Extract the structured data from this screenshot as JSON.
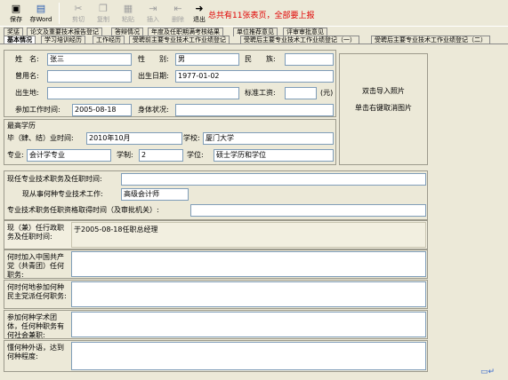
{
  "toolbar": {
    "buttons": [
      {
        "label": "保存",
        "icon": "save-icon",
        "enabled": true
      },
      {
        "label": "存Word",
        "icon": "word-icon",
        "enabled": true
      },
      {
        "label": "剪切",
        "icon": "cut-icon",
        "enabled": false
      },
      {
        "label": "复制",
        "icon": "copy-icon",
        "enabled": false
      },
      {
        "label": "粘贴",
        "icon": "paste-icon",
        "enabled": false
      },
      {
        "label": "插入",
        "icon": "insert-icon",
        "enabled": false
      },
      {
        "label": "删除",
        "icon": "delete-icon",
        "enabled": false
      },
      {
        "label": "退出",
        "icon": "exit-icon",
        "enabled": true
      }
    ],
    "notice": "总共有11张表页，全部要上报"
  },
  "tabs_row1": [
    "奖惩",
    "论文及重要技术报告登记",
    "答辩情况",
    "年度及任职期满考核结果",
    "单位推荐意见",
    "评审审批意见"
  ],
  "tabs_row2": [
    "基本情况",
    "学习培训经历",
    "工作经历",
    "受聘前主要专业技术工作业绩登记",
    "受聘后主要专业技术工作业绩登记（一）",
    "受聘后主要专业技术工作业绩登记（二）"
  ],
  "active_tab": "基本情况",
  "basic": {
    "name_label": "姓　名:",
    "name": "张三",
    "gender_label": "性　　别:",
    "gender": "男",
    "ethnic_label": "民　　族:",
    "ethnic": "",
    "former_name_label": "曾用名:",
    "former_name": "",
    "birth_label": "出生日期:",
    "birth": "1977-01-02",
    "birthplace_label": "出生地:",
    "birthplace": "",
    "salary_label": "标准工资:",
    "salary": "",
    "salary_unit": "(元)",
    "work_start_label": "参加工作时间:",
    "work_start": "2005-08-18",
    "health_label": "身体状况:",
    "health": ""
  },
  "photo": {
    "line1": "双击导入照片",
    "line2": "单击右键取消图片"
  },
  "education": {
    "section_title": "最高学历",
    "grad_time_label": "毕（肄、结）业时间:",
    "grad_time": "2010年10月",
    "school_label": "学校:",
    "school": "厦门大学",
    "major_label": "专业:",
    "major": "会计学专业",
    "length_label": "学制:",
    "length": "2",
    "degree_label": "学位:",
    "degree": "硕士学历和学位"
  },
  "profession": {
    "current_title_time_label": "现任专业技术职务及任职时间:",
    "current_title_time": "",
    "current_work_label": "现从事何种专业技术工作:",
    "current_work": "高级会计师",
    "qualification_label": "专业技术职务任职资格取得时间（及审批机关）:",
    "qualification": ""
  },
  "admin": {
    "label": "现（兼）任行政职务及任职时间:",
    "value": "于2005-08-18任职总经理"
  },
  "party": {
    "label": "何时加入中国共产党（共青团）任何职务:",
    "value": ""
  },
  "other_party": {
    "label": "何时何地参加何种民主党派任何职务:",
    "value": ""
  },
  "society": {
    "label": "参加何种学术团体，任何种职务有何社会兼职:",
    "value": ""
  },
  "language": {
    "label": "懂何种外语，达到何种程度:",
    "value": ""
  }
}
